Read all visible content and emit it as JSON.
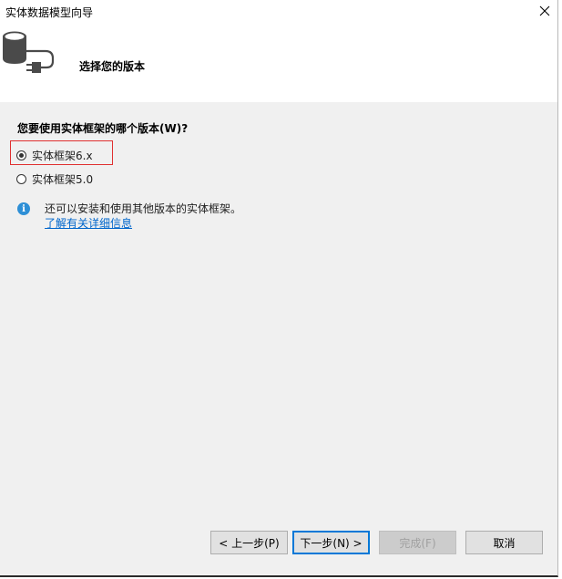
{
  "window": {
    "title": "实体数据模型向导"
  },
  "header": {
    "title": "选择您的版本"
  },
  "content": {
    "question": "您要使用实体框架的哪个版本(W)?",
    "options": [
      {
        "label": "实体框架6.x",
        "selected": true
      },
      {
        "label": "实体框架5.0",
        "selected": false
      }
    ],
    "info_text": "还可以安装和使用其他版本的实体框架。",
    "info_link": "了解有关详细信息"
  },
  "buttons": {
    "prev": "< 上一步(P)",
    "next": "下一步(N) >",
    "finish": "完成(F)",
    "cancel": "取消"
  },
  "colors": {
    "accent": "#0078d7",
    "highlight": "#e03030",
    "link": "#0066cc",
    "info_icon": "#2e8fd6"
  }
}
